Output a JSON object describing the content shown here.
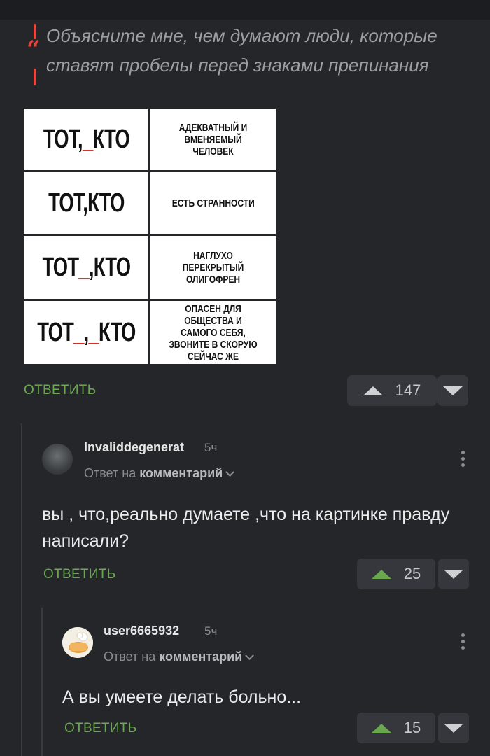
{
  "quote": {
    "text": "Объясните мне, чем думают люди, которые ставят пробелы перед знаками препинания"
  },
  "meme": {
    "rows": [
      {
        "left_a": "ТОТ,",
        "left_space": "_",
        "left_b": "КТО",
        "right": "АДЕКВАТНЫЙ И ВМЕНЯЕМЫЙ ЧЕЛОВЕК"
      },
      {
        "left": "ТОТ,КТО",
        "right": "ЕСТЬ СТРАННОСТИ"
      },
      {
        "left_a": "ТОТ",
        "left_space": "_",
        "left_b": ",КТО",
        "right": "НАГЛУХО ПЕРЕКРЫТЫЙ ОЛИГОФРЕН"
      },
      {
        "left_a": "ТОТ",
        "left_space": "_",
        "left_mid": ",",
        "left_space2": "_",
        "left_b": "КТО",
        "right": "ОПАСЕН ДЛЯ ОБЩЕСТВА И САМОГО СЕБЯ, ЗВОНИТЕ В СКОРУЮ СЕЙЧАС ЖЕ"
      }
    ]
  },
  "post": {
    "reply_label": "ОТВЕТИТЬ",
    "votes": "147"
  },
  "comment1": {
    "username": "Invaliddegenerat",
    "time": "5ч",
    "reply_prefix": "Ответ на",
    "reply_target": "комментарий",
    "text": "вы , что,реально думаете ,что на картинке правду написали?",
    "reply_label": "ОТВЕТИТЬ",
    "votes": "25"
  },
  "comment2": {
    "username": "user6665932",
    "time": "5ч",
    "reply_prefix": "Ответ на",
    "reply_target": "комментарий",
    "text": "А вы умеете делать больно...",
    "reply_label": "ОТВЕТИТЬ",
    "votes": "15"
  },
  "colors": {
    "background": "#25262a",
    "accent_green": "#6aa84f",
    "quote_red": "#e8453c"
  },
  "icons": [
    "quote-icon",
    "upvote-icon",
    "downvote-icon",
    "more-vertical-icon",
    "chevron-down-icon",
    "avatar"
  ]
}
